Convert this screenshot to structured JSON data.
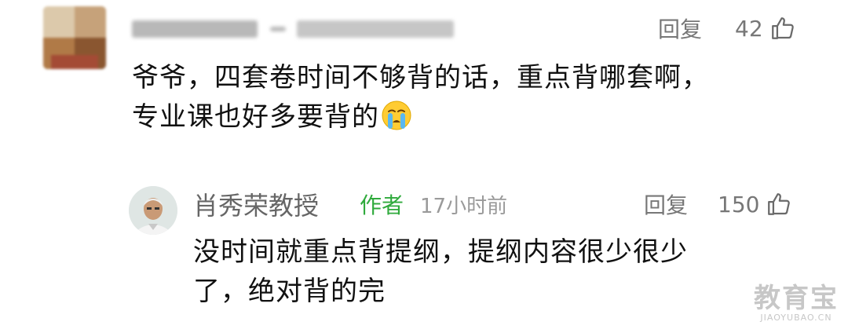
{
  "comment": {
    "author_name": "",
    "timestamp": "",
    "reply_label": "回复",
    "likes": "42",
    "text_lines": [
      "爷爷，四套卷时间不够背的话，重点背哪套啊，",
      "专业课也好多要背的"
    ],
    "emoji": "crying-face"
  },
  "reply": {
    "author_name": "肖秀荣教授",
    "author_badge": "作者",
    "timestamp": "17小时前",
    "reply_label": "回复",
    "likes": "150",
    "text_lines": [
      "没时间就重点背提纲，提纲内容很少很少",
      "了，绝对背的完"
    ]
  },
  "watermark": {
    "brand": "教育宝",
    "url": "JIAOYUBAO.CN"
  },
  "icons": {
    "like": "thumbs-up-icon",
    "emoji": "crying-face-emoji-icon"
  },
  "colors": {
    "author_badge": "#2faa3c",
    "meta_text": "#777777",
    "body_text": "#111111"
  }
}
